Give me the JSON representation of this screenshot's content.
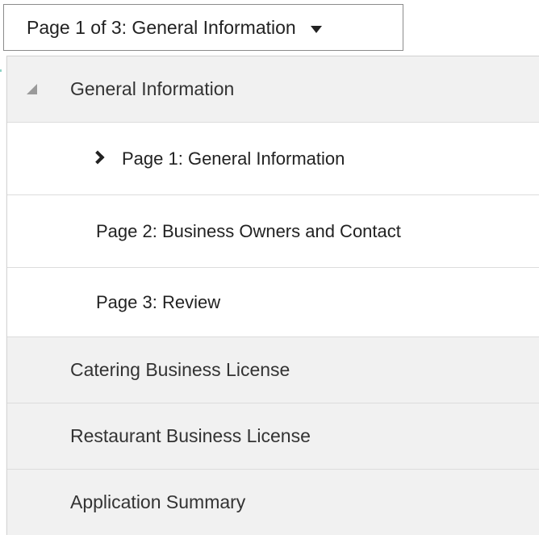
{
  "selector": {
    "label": "Page 1 of 3: General Information"
  },
  "menu": {
    "sections": [
      {
        "label": "General Information",
        "expanded": true,
        "pages": [
          {
            "label": "Page 1: General Information",
            "current": true
          },
          {
            "label": "Page 2: Business Owners and Contact",
            "current": false
          },
          {
            "label": "Page 3: Review",
            "current": false
          }
        ]
      },
      {
        "label": "Catering Business License",
        "expanded": false
      },
      {
        "label": "Restaurant Business License",
        "expanded": false
      },
      {
        "label": "Application Summary",
        "expanded": false
      }
    ]
  },
  "icons": {
    "selector_caret": "caret-down-icon",
    "section_toggle": "expand-triangle-icon",
    "current_page_marker": "chevron-right-icon"
  },
  "colors": {
    "section_background": "#f1f1f1",
    "page_background": "#ffffff",
    "border": "#dcdcdc",
    "text": "#333333"
  }
}
